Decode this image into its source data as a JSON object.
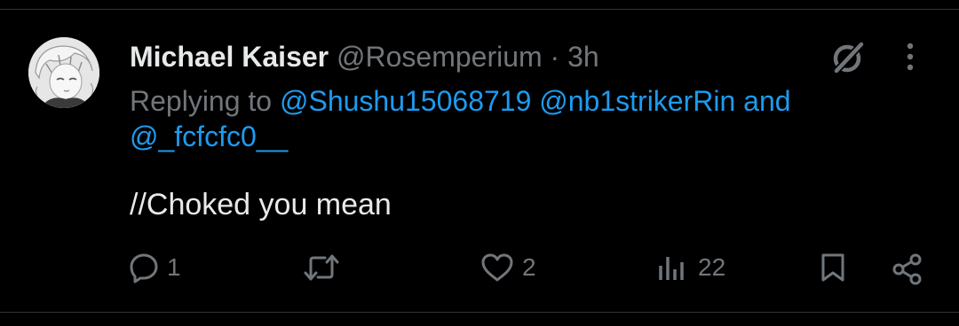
{
  "tweet": {
    "display_name": "Michael Kaiser",
    "handle": "@Rosemperium",
    "separator": "·",
    "time": "3h",
    "replying_prefix": "Replying to",
    "mention_1": "@Shushu15068719",
    "mention_2": "@nb1strikerRin",
    "mention_joiner": "and",
    "mention_3": "@_fcfcfc0__",
    "text": "//Choked you mean"
  },
  "actions": {
    "reply_count": "1",
    "retweet_count": "",
    "like_count": "2",
    "view_count": "22"
  },
  "icons": {
    "grok": "grok-icon",
    "more": "more-vertical-icon",
    "reply": "reply-icon",
    "retweet": "retweet-icon",
    "like": "heart-icon",
    "views": "views-icon",
    "bookmark": "bookmark-icon",
    "share": "share-icon"
  },
  "colors": {
    "background": "#000000",
    "primary_text": "#e7e9ea",
    "secondary_text": "#71767b",
    "link": "#1d9bf0",
    "divider": "#2f3336"
  }
}
